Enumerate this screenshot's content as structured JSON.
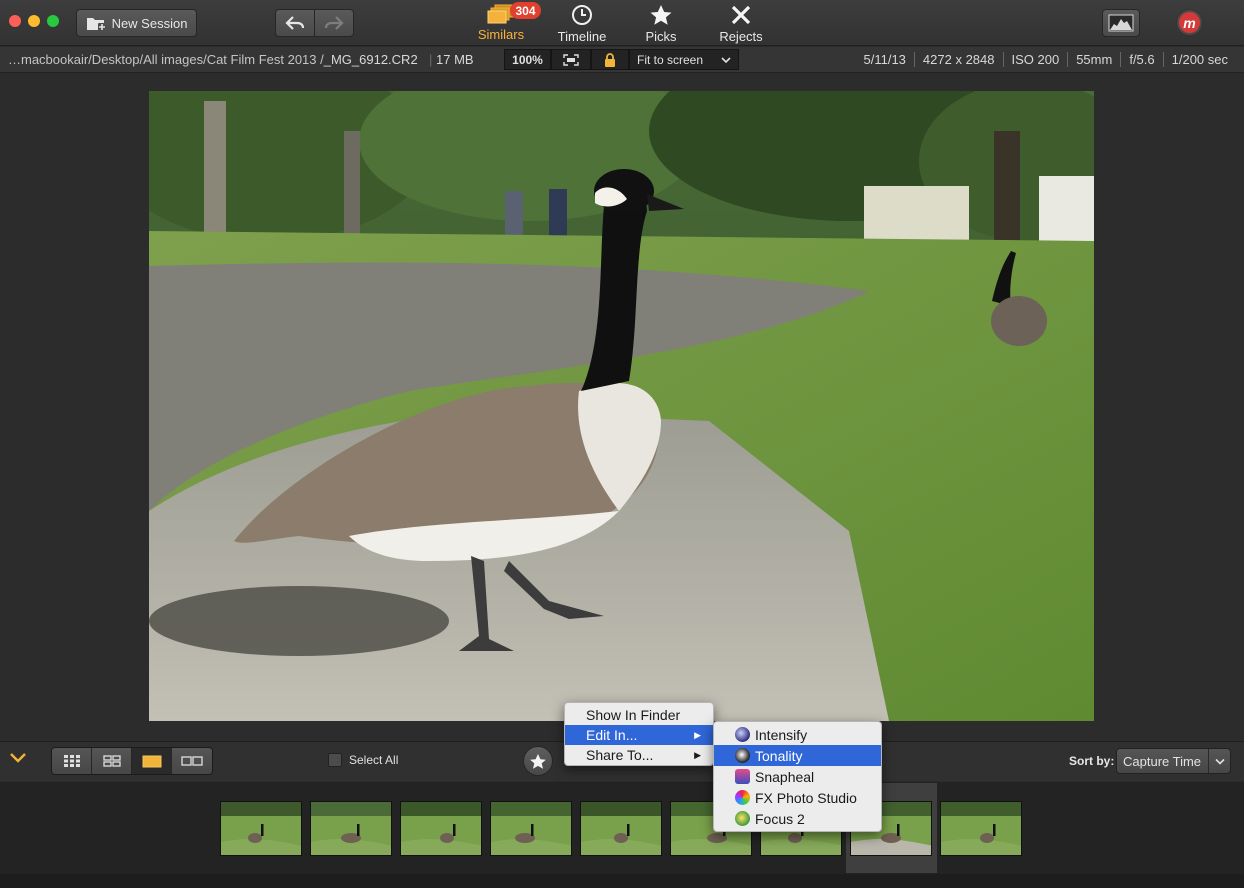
{
  "toolbar": {
    "new_session_label": "New Session",
    "views": [
      {
        "label": "Similars",
        "badge": "304",
        "active": true
      },
      {
        "label": "Timeline"
      },
      {
        "label": "Picks"
      },
      {
        "label": "Rejects"
      }
    ],
    "accent_color": "#f5b23a"
  },
  "infobar": {
    "path": "…macbookair/Desktop/All images/Cat Film Fest 2013 /",
    "filename": "_MG_6912.CR2",
    "filesize": "17 MB",
    "zoom_percent": "100%",
    "fit_option": "Fit to screen",
    "meta": {
      "date": "5/11/13",
      "dimensions": "4272 x 2848",
      "iso": "ISO 200",
      "focal": "55mm",
      "aperture": "f/5.6",
      "shutter": "1/200 sec"
    }
  },
  "bottombar": {
    "select_all_label": "Select All",
    "sort_by_label": "Sort by:",
    "sort_value": "Capture Time"
  },
  "context_menu": {
    "items": [
      {
        "label": "Show In Finder"
      },
      {
        "label": "Edit In...",
        "highlighted": true,
        "has_submenu": true
      },
      {
        "label": "Share To...",
        "has_submenu": true
      }
    ],
    "submenu": [
      {
        "label": "Intensify",
        "icon": "intensify-icon"
      },
      {
        "label": "Tonality",
        "icon": "tonality-icon",
        "highlighted": true
      },
      {
        "label": "Snapheal",
        "icon": "snapheal-icon"
      },
      {
        "label": "FX Photo Studio",
        "icon": "fx-photo-studio-icon"
      },
      {
        "label": "Focus 2",
        "icon": "focus-2-icon"
      }
    ]
  }
}
